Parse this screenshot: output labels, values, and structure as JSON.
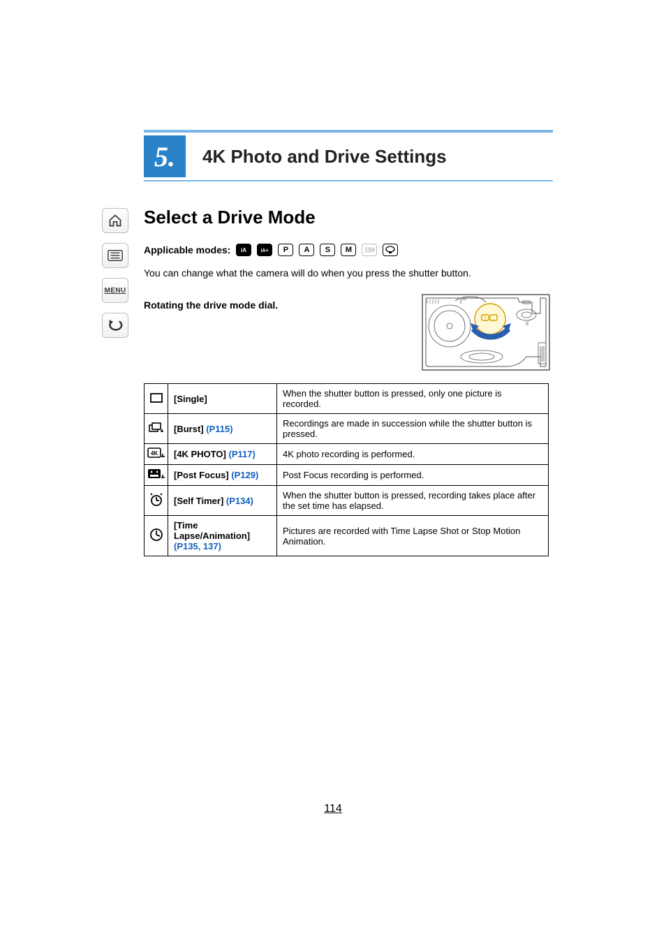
{
  "page_number": "114",
  "chapter": {
    "num": "5.",
    "title": "4K Photo and Drive Settings"
  },
  "nav": {
    "home": "home-icon",
    "toc": "toc-icon",
    "menu_label": "MENU",
    "back": "back-icon"
  },
  "heading": "Select a Drive Mode",
  "applicable_modes_label": "Applicable modes:",
  "modes": {
    "ia": "iA",
    "iap": "iA+",
    "p": "P",
    "a": "A",
    "s": "S",
    "m": "M",
    "mov": "▮M",
    "palette": "palette"
  },
  "intro": "You can change what the camera will do when you press the shutter button.",
  "instruction": "Rotating the drive mode dial.",
  "table": [
    {
      "icon": "single-icon",
      "label": "[Single]",
      "link": "",
      "desc": "When the shutter button is pressed, only one picture is recorded."
    },
    {
      "icon": "burst-icon",
      "label": "[Burst] ",
      "link": "(P115)",
      "desc": "Recordings are made in succession while the shutter button is pressed."
    },
    {
      "icon": "4k-icon",
      "label": "[4K PHOTO] ",
      "link": "(P117)",
      "desc": "4K photo recording is performed."
    },
    {
      "icon": "postfocus-icon",
      "label": "[Post Focus] ",
      "link": "(P129)",
      "desc": "Post Focus recording is performed."
    },
    {
      "icon": "selftimer-icon",
      "label": "[Self Timer] ",
      "link": "(P134)",
      "desc": "When the shutter button is pressed, recording takes place after the set time has elapsed."
    },
    {
      "icon": "timelapse-icon",
      "label": "[Time Lapse/Animation] ",
      "link": "(P135, 137)",
      "desc": "Pictures are recorded with Time Lapse Shot or Stop Motion Animation."
    }
  ]
}
